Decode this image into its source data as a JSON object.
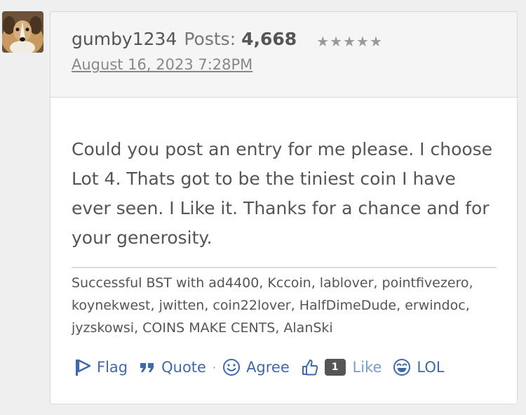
{
  "post": {
    "author": "gumby1234",
    "posts_label": "Posts:",
    "posts_count": "4,668",
    "rank_stars": 5,
    "date": "August 16, 2023 7:28PM",
    "body": "Could you post an entry for me please. I choose Lot 4. Thats got to be the tiniest coin I have ever seen. I Like it. Thanks for a chance and for your generosity.",
    "signature": "Successful BST with ad4400, Kccoin, lablover, pointfivezero, koynekwest, jwitten, coin22lover, HalfDimeDude, erwindoc, jyzskowsi, COINS MAKE CENTS, AlanSki"
  },
  "reactions": {
    "flag": "Flag",
    "quote": "Quote",
    "agree": "Agree",
    "like_count": "1",
    "like": "Like",
    "lol": "LOL"
  },
  "colors": {
    "link": "#3f6aa9",
    "text": "#555555",
    "badge": "#555555"
  }
}
